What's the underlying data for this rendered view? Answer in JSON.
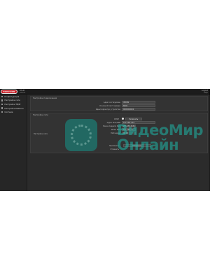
{
  "header": {
    "logo_text": "HIKVISION",
    "title_line1": "DS-ID",
    "title_line2": "Admin",
    "right_line1": "Logout",
    "right_line2": "Help"
  },
  "sidebar": {
    "items": [
      {
        "label": "Конфигурация"
      },
      {
        "label": "Настройки сети"
      },
      {
        "label": "Настройки ТВ/IP"
      },
      {
        "label": "Настройки Platform"
      },
      {
        "label": "Система"
      }
    ]
  },
  "section1": {
    "title": "Настройки подключения",
    "rows": [
      {
        "label": "Адрес хоста/домен",
        "value": "IP/DNS"
      },
      {
        "label": "Основной порт сервера",
        "value": "8000"
      },
      {
        "label": "Идентификатор устройства",
        "value": "0000000000"
      }
    ]
  },
  "section2": {
    "title": "Настройки сети",
    "side_label": "Настройки сети",
    "toggle": {
      "label": "DHCP",
      "button": "Включить"
    },
    "rows": [
      {
        "label": "Адрес IPv4/DNS",
        "value": "192.168.1.64"
      },
      {
        "label": "Маска подсети IPv4",
        "value": "255.255.255.0"
      },
      {
        "label": "Шлюз IPv4",
        "value": "192.168.1.1"
      },
      {
        "label": "MAC-адрес",
        "value": "00:00"
      }
    ],
    "footer_rows": [
      {
        "label": "Применить",
        "button": "Сохранить"
      },
      {
        "label": "Отменить",
        "button": ""
      }
    ]
  },
  "watermark": {
    "line1": "ВидеоМир",
    "line2": "Онлайн"
  }
}
